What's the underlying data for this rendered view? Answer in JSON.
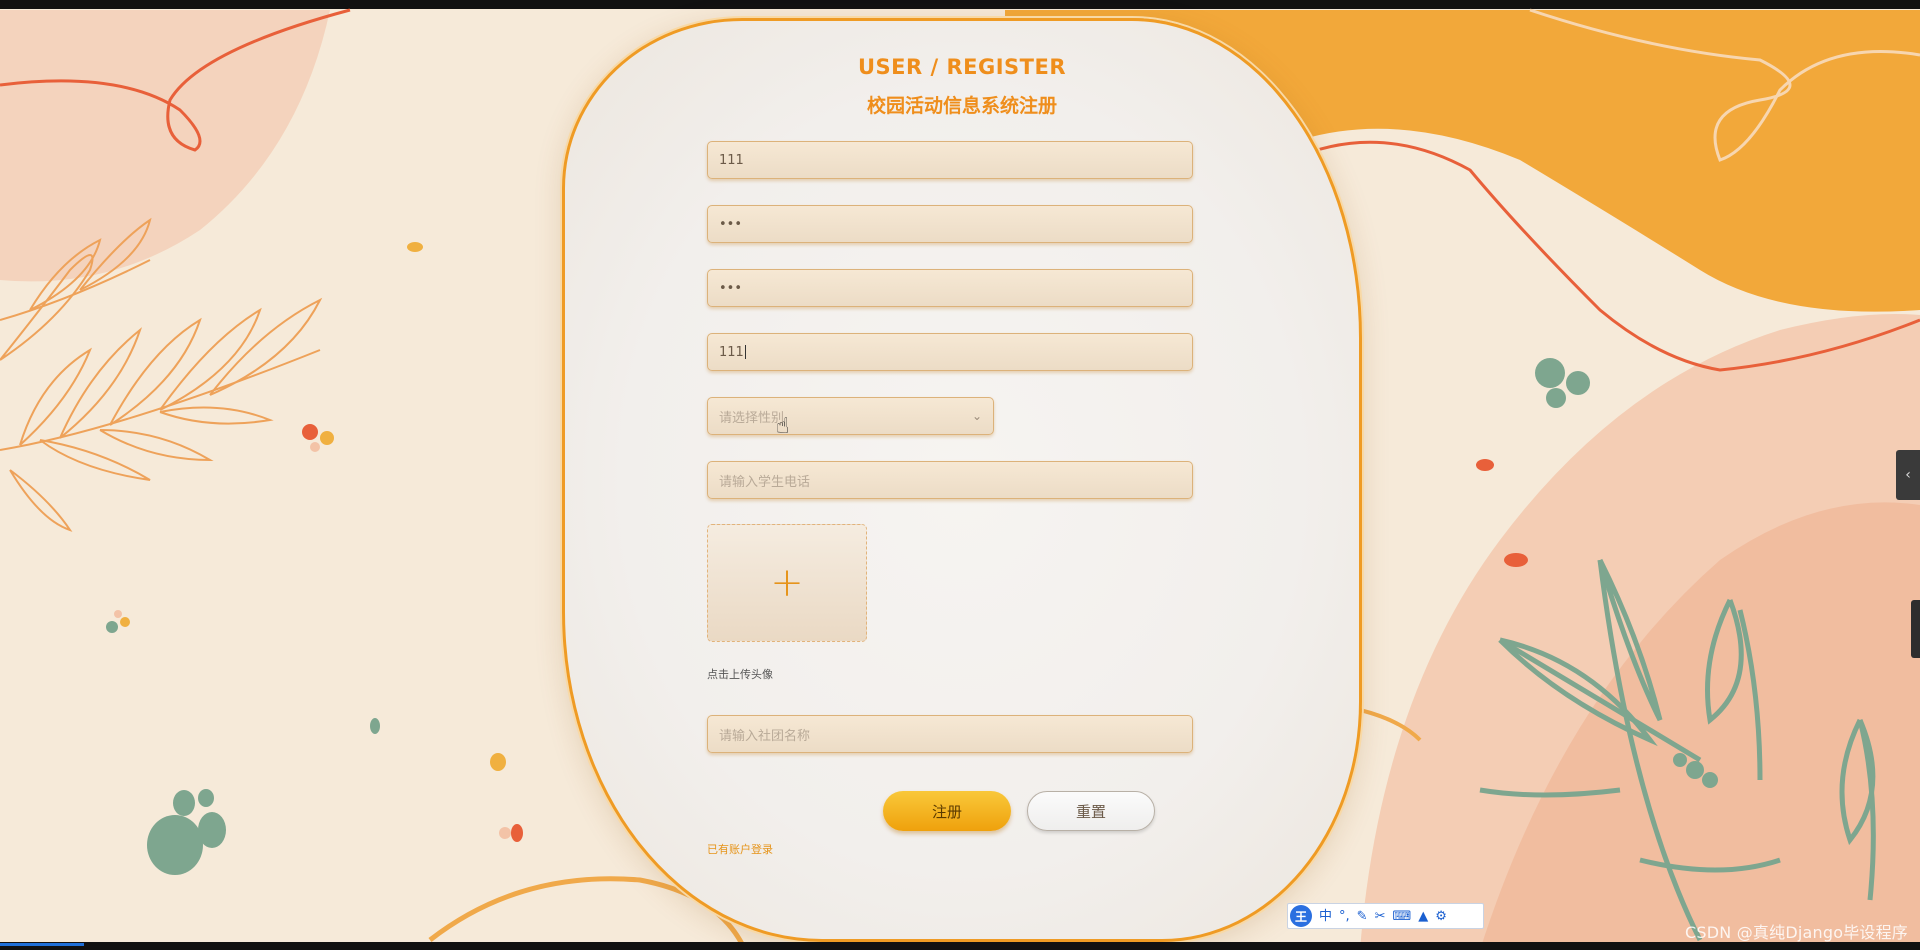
{
  "page": {
    "title_en": "USER / REGISTER",
    "title_cn": "校园活动信息系统注册"
  },
  "form": {
    "account_value": "111",
    "password_value": "•••",
    "confirm_password_value": "•••",
    "name_value": "111",
    "gender_placeholder": "请选择性别",
    "phone_placeholder": "请输入学生电话",
    "avatar_hint": "点击上传头像",
    "club_placeholder": "请输入社团名称"
  },
  "buttons": {
    "register_label": "注册",
    "reset_label": "重置",
    "login_link": "已有账户登录"
  },
  "ime_toolbar": {
    "logo": "王",
    "mode": "中",
    "punct": "°,"
  },
  "watermark": "CSDN @真纯Django毕设程序",
  "colors": {
    "accent": "#ef8e1c",
    "card_border": "#ef9b24",
    "register_button": "#f4b420",
    "background": "#f6ead9",
    "orange_blob": "#f2a83a",
    "peach_blob": "#f3c3a7",
    "leaf_green": "#7ea68f"
  },
  "icons": {
    "upload": "plus-icon",
    "select": "chevron-down-icon",
    "side_panel": "chevron-left-icon",
    "cursor": "hand-pointer-icon"
  }
}
